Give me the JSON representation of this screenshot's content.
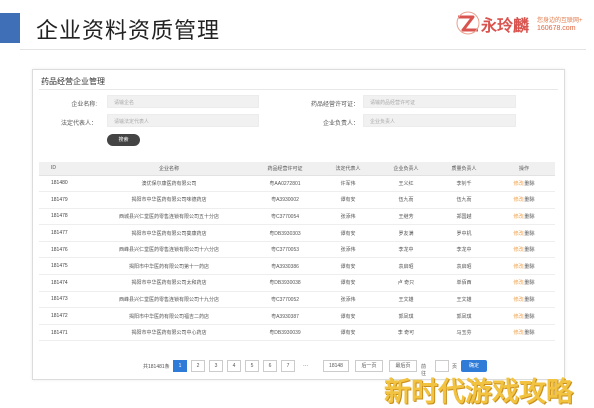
{
  "slide": {
    "title": "企业资料资质管理",
    "accent_color": "#3f6fb6"
  },
  "brand": {
    "name": "永玲麟",
    "tagline": "您身边的互联网+",
    "url": "160678.com",
    "logo_icon": "brand-logo-icon",
    "color": "#d9534f"
  },
  "panel": {
    "title": "药品经营企业管理"
  },
  "form": {
    "company_name_label": "企业名称:",
    "company_name_placeholder": "请输企名",
    "license_label": "药品经营许可证：",
    "license_placeholder": "请输药品经营许可证",
    "legal_rep_label": "法定代表人：",
    "legal_rep_placeholder": "请输法定代表人",
    "manager_label": "企业负责人：",
    "manager_placeholder": "企业负责人",
    "search_label": "搜索"
  },
  "table": {
    "headers": [
      "ID",
      "企业名称",
      "药品经营许可证",
      "法定代表人",
      "企业负责人",
      "质量负责人",
      "操作"
    ],
    "edit_label": "修改",
    "separator": "|",
    "delete_label": "删除",
    "rows": [
      {
        "id": "181480",
        "name": "澳优保尔康医药有限公司",
        "license": "粤AA0272801",
        "legal": "许军伟",
        "manager": "王义红",
        "quality": "李钊千"
      },
      {
        "id": "181479",
        "name": "揭阳市中华医药有限公司味德药店",
        "license": "粤A3930002",
        "legal": "谭有安",
        "manager": "伍九而",
        "quality": "伍九而"
      },
      {
        "id": "181478",
        "name": "西城县兴仁堂医药零售连锁有限公司五十分店",
        "license": "粤C3770054",
        "legal": "张添伟",
        "manager": "王继芳",
        "quality": "郑国越"
      },
      {
        "id": "181477",
        "name": "揭阳市中华医药有限公司葵康药店",
        "license": "粤DB3930303",
        "legal": "谭有安",
        "manager": "罗友满",
        "quality": "罗中机"
      },
      {
        "id": "181476",
        "name": "西峰县兴仁堂医药零售连锁有限公司十六分店",
        "license": "粤C3770053",
        "legal": "张添伟",
        "manager": "李龙中",
        "quality": "李龙中"
      },
      {
        "id": "181475",
        "name": "揭阳市中华医药有限公司第十一药店",
        "license": "粤A3930386",
        "legal": "谭有安",
        "manager": "袁启昭",
        "quality": "袁启昭"
      },
      {
        "id": "181474",
        "name": "揭阳市中华医药有限公司太和药店",
        "license": "粤DB3930038",
        "legal": "谭有安",
        "manager": "卢 奇只",
        "quality": "单佰西"
      },
      {
        "id": "181473",
        "name": "西峰县兴仁堂医药零售连锁有限公司十九分店",
        "license": "粤C3770052",
        "legal": "张添伟",
        "manager": "王文雄",
        "quality": "王文雄"
      },
      {
        "id": "181472",
        "name": "揭阳市中华医药有限公司福吉二药店",
        "license": "粤A3930387",
        "legal": "谭有安",
        "manager": "郭凤琪",
        "quality": "郭凤琪"
      },
      {
        "id": "181471",
        "name": "揭阳市中华医药有限公司中心药店",
        "license": "粤DB3930039",
        "legal": "谭有安",
        "manager": "李 奇可",
        "quality": "马玉芬"
      }
    ]
  },
  "pagination": {
    "total_label": "共181481条",
    "pages": [
      "1",
      "2",
      "3",
      "4",
      "5",
      "6",
      "7"
    ],
    "ellipsis": "...",
    "last_page": "18148",
    "next_label": "后一页",
    "last_label": "最后页",
    "goto_label": "前往",
    "page_unit": "页",
    "go_label": "确定",
    "active_page": "1",
    "active_color": "#2f7bd8"
  },
  "watermark": {
    "text": "新时代游戏攻略"
  }
}
